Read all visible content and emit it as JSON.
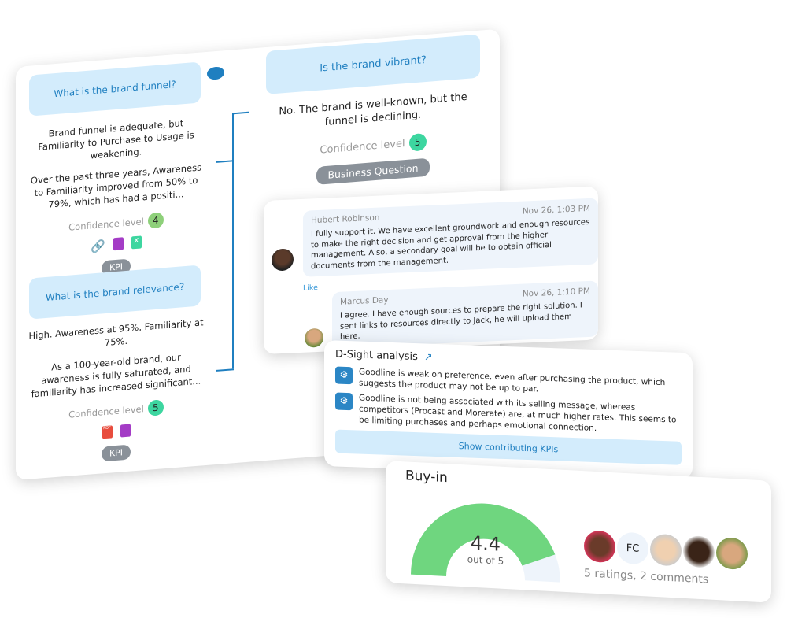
{
  "main_panel": {
    "left": {
      "items": [
        {
          "question": "What is the brand funnel?",
          "answer_summary": "Brand funnel is adequate, but Familiarity to Purchase to Usage is weakening.",
          "answer_detail": "Over the past three years, Awareness to Familiarity improved from 50% to 79%, which has had a positi...",
          "confidence_label": "Confidence level",
          "confidence_value": "4",
          "confidence_color": "#8ed07a",
          "attachments": [
            "link-icon",
            "copy-icon",
            "excel-file-icon"
          ],
          "tag": "KPI"
        },
        {
          "question": "What is the brand relevance?",
          "answer_summary": "High. Awareness at 95%, Familiarity at 75%.",
          "answer_detail": "As a 100-year-old brand, our awareness is fully saturated, and familiarity has increased significant...",
          "confidence_label": "Confidence level",
          "confidence_value": "5",
          "confidence_color": "#3dd6a0",
          "attachments": [
            "pdf-file-icon",
            "copy-icon"
          ],
          "tag": "KPI"
        }
      ]
    },
    "right": {
      "question": "Is the brand vibrant?",
      "answer": "No. The brand is well-known, but the funnel is declining.",
      "confidence_label": "Confidence level",
      "confidence_value": "5",
      "confidence_color": "#3dd6a0",
      "tag": "Business Question"
    }
  },
  "comments": [
    {
      "author": "Hubert Robinson",
      "time": "Nov 26, 1:03 PM",
      "text": "I fully support it. We have excellent groundwork and enough resources to make the right decision and get approval from the higher management.  Also, a secondary goal will be to obtain official documents from the management.",
      "action": "Like"
    },
    {
      "author": "Marcus Day",
      "time": "Nov 26, 1:10 PM",
      "text": "I agree. I have enough sources to prepare the right solution.  I sent links to resources directly to Jack, he will upload them here."
    }
  ],
  "dsight": {
    "title": "D-Sight analysis",
    "insights": [
      "Goodline is weak on preference, even after purchasing the product, which suggests the product may not be up to par.",
      "Goodline is not being associated with its selling message, whereas competitors (Procast and Morerate) are, at much higher rates. This seems to be limiting purchases and perhaps emotional connection."
    ],
    "button": "Show contributing KPIs"
  },
  "buyin": {
    "title": "Buy-in",
    "score": "4.4",
    "out_of": "out of 5",
    "score_value": 4.4,
    "max": 5,
    "gauge_color": "#6fd67f",
    "raters_initials": "FC",
    "summary": "5 ratings, 2 comments"
  },
  "colors": {
    "accent": "#1f7fc0",
    "question_bg": "#d3ecfc"
  }
}
